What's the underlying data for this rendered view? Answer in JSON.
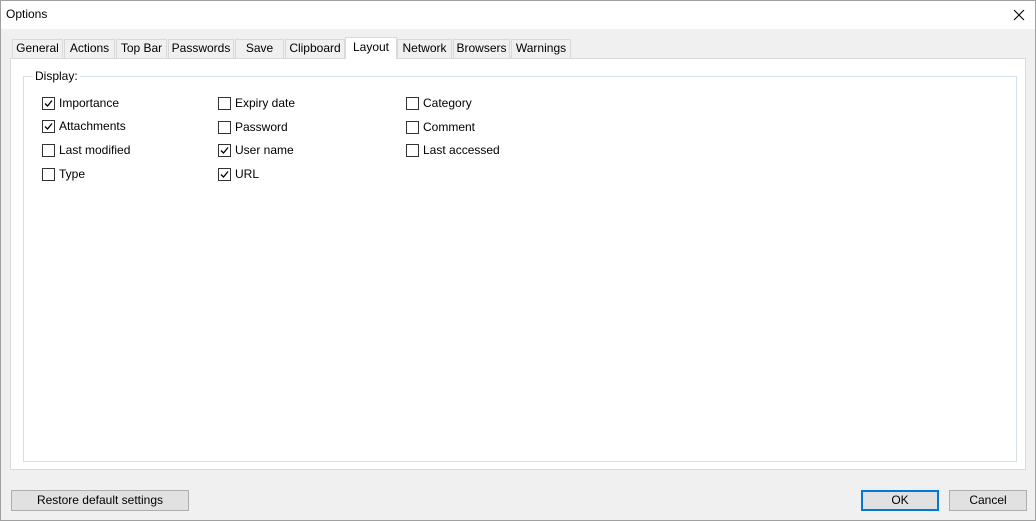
{
  "window": {
    "title": "Options"
  },
  "tabs": [
    {
      "label": "General"
    },
    {
      "label": "Actions"
    },
    {
      "label": "Top Bar"
    },
    {
      "label": "Passwords"
    },
    {
      "label": "Save"
    },
    {
      "label": "Clipboard"
    },
    {
      "label": "Layout"
    },
    {
      "label": "Network"
    },
    {
      "label": "Browsers"
    },
    {
      "label": "Warnings"
    }
  ],
  "active_tab": "Layout",
  "display": {
    "label": "Display:",
    "options": [
      {
        "label": "Importance",
        "checked": true
      },
      {
        "label": "Attachments",
        "checked": true
      },
      {
        "label": "Last modified",
        "checked": false
      },
      {
        "label": "Type",
        "checked": false
      },
      {
        "label": "Expiry date",
        "checked": false
      },
      {
        "label": "Password",
        "checked": false
      },
      {
        "label": "User name",
        "checked": true
      },
      {
        "label": "URL",
        "checked": true
      },
      {
        "label": "Category",
        "checked": false
      },
      {
        "label": "Comment",
        "checked": false
      },
      {
        "label": "Last accessed",
        "checked": false
      }
    ]
  },
  "buttons": {
    "restore": "Restore default settings",
    "ok": "OK",
    "cancel": "Cancel"
  },
  "icons": {
    "close": "close-icon",
    "check": "checkmark-icon"
  }
}
